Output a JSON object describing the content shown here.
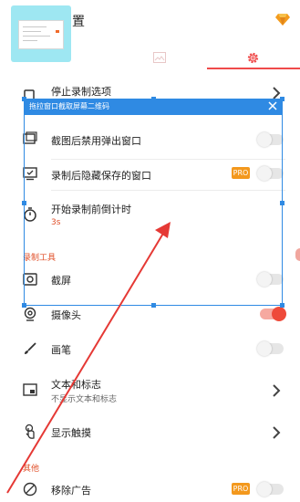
{
  "header": {
    "title_fragment": "置",
    "accent_color": "#ef4a4a",
    "icons": [
      "diamond-icon",
      "image-icon",
      "gear-icon"
    ]
  },
  "capture_overlay": {
    "hint": "拖拉窗口截取屏幕二维码",
    "close_icon": "close-icon",
    "color": "#2f8ae3"
  },
  "rows": {
    "stop_record": {
      "label": "停止录制选项"
    },
    "disable_popup": {
      "label": "截图后禁用弹出窗口",
      "toggle": false
    },
    "hide_saved": {
      "label": "录制后隐藏保存的窗口",
      "badge": "PRO",
      "toggle": false
    },
    "countdown": {
      "label": "开始录制前倒计时",
      "value": "3s"
    },
    "screenshot": {
      "label": "截屏",
      "toggle": false
    },
    "camera": {
      "label": "摄像头",
      "toggle": true
    },
    "brush": {
      "label": "画笔",
      "toggle": false
    },
    "text_logo": {
      "label": "文本和标志",
      "sub": "不显示文本和标志"
    },
    "show_touch": {
      "label": "显示触摸"
    },
    "remove_ads": {
      "label": "移除广告",
      "badge": "PRO",
      "toggle": false
    }
  },
  "sections": {
    "record_tools": "录制工具",
    "other": "其他"
  },
  "colors": {
    "toggle_on": "#ee4a3a",
    "pro_badge": "#f3981d",
    "section_text": "#e0502a",
    "arrow": "#e53935"
  }
}
